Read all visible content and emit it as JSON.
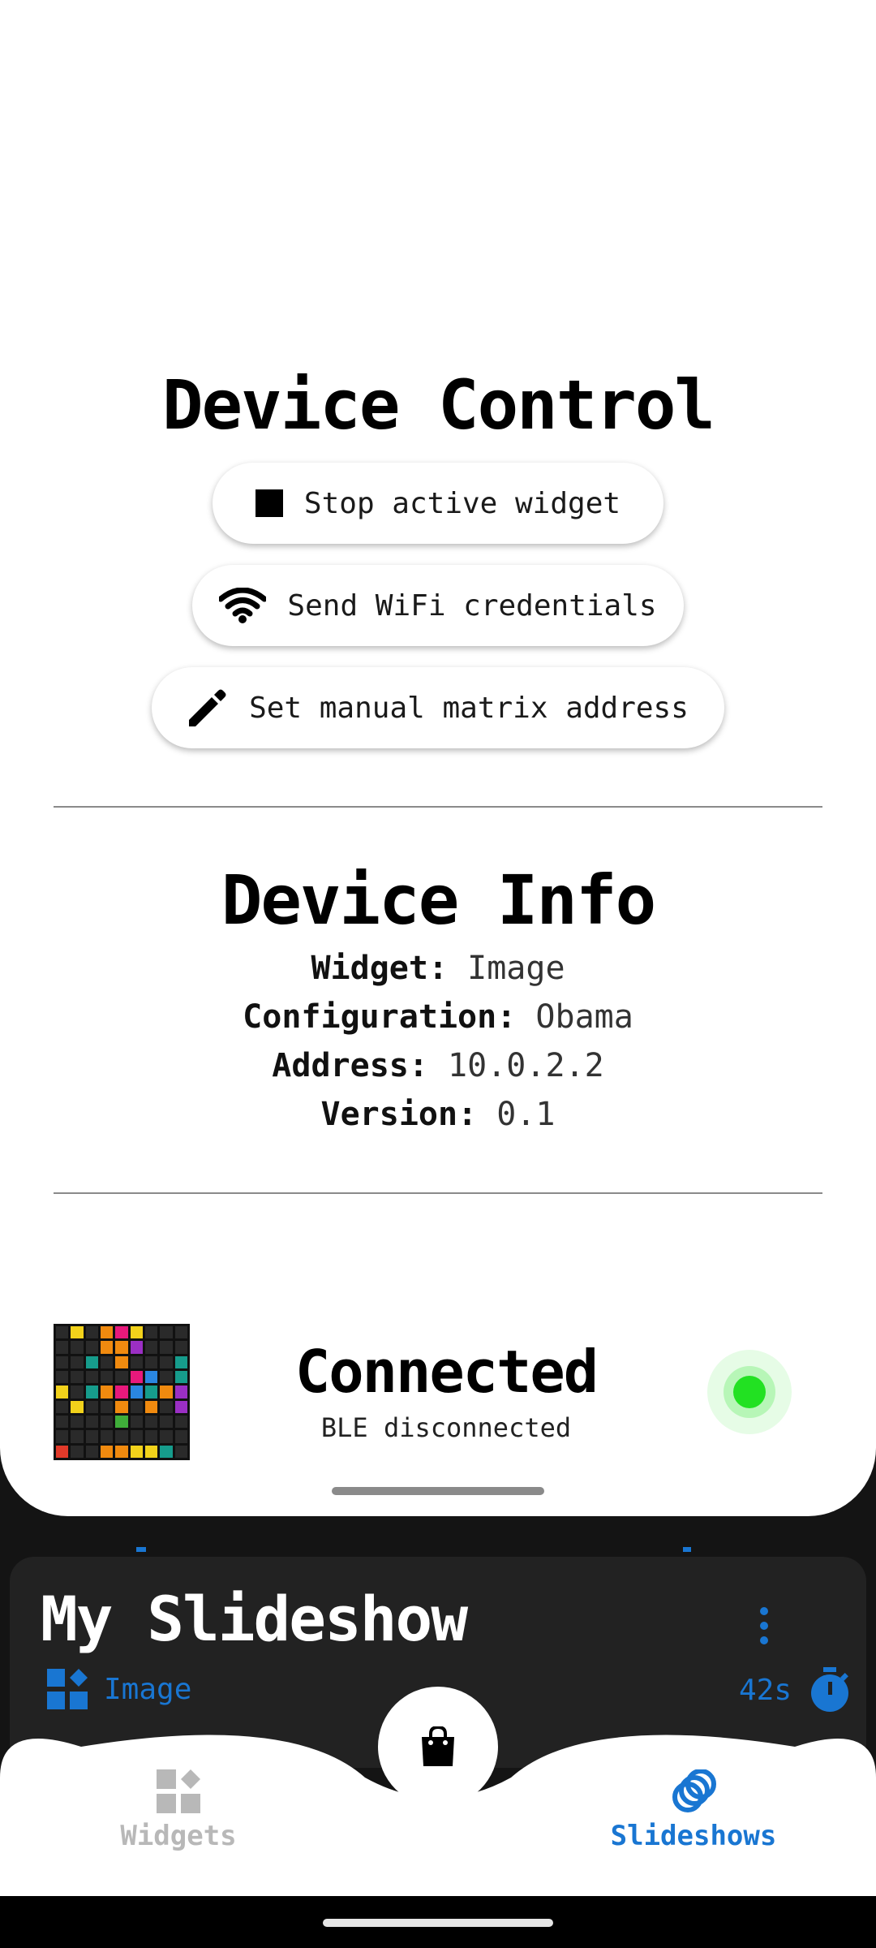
{
  "device_control": {
    "title": "Device Control",
    "buttons": [
      {
        "label": "Stop active widget",
        "icon": "stop-icon"
      },
      {
        "label": "Send WiFi credentials",
        "icon": "wifi-icon"
      },
      {
        "label": "Set manual matrix address",
        "icon": "pencil-icon"
      }
    ]
  },
  "device_info": {
    "title": "Device Info",
    "rows": [
      {
        "label": "Widget:",
        "value": "Image"
      },
      {
        "label": "Configuration:",
        "value": "Obama"
      },
      {
        "label": "Address:",
        "value": "10.0.2.2"
      },
      {
        "label": "Version:",
        "value": "0.1"
      }
    ]
  },
  "status": {
    "title": "Connected",
    "subtitle": "BLE disconnected",
    "indicator_color": "#22e122"
  },
  "slideshow_card": {
    "title": "My Slideshow",
    "item_label": "Image",
    "item_icon": "widgets-icon",
    "duration": "42s",
    "duration_icon": "timer-icon"
  },
  "nav": {
    "widgets_label": "Widgets",
    "slideshows_label": "Slideshows",
    "fab_icon": "shopping-bag-icon",
    "active": "Slideshows",
    "accent_color": "#1976d2",
    "inactive_color": "#b8b8b8"
  }
}
